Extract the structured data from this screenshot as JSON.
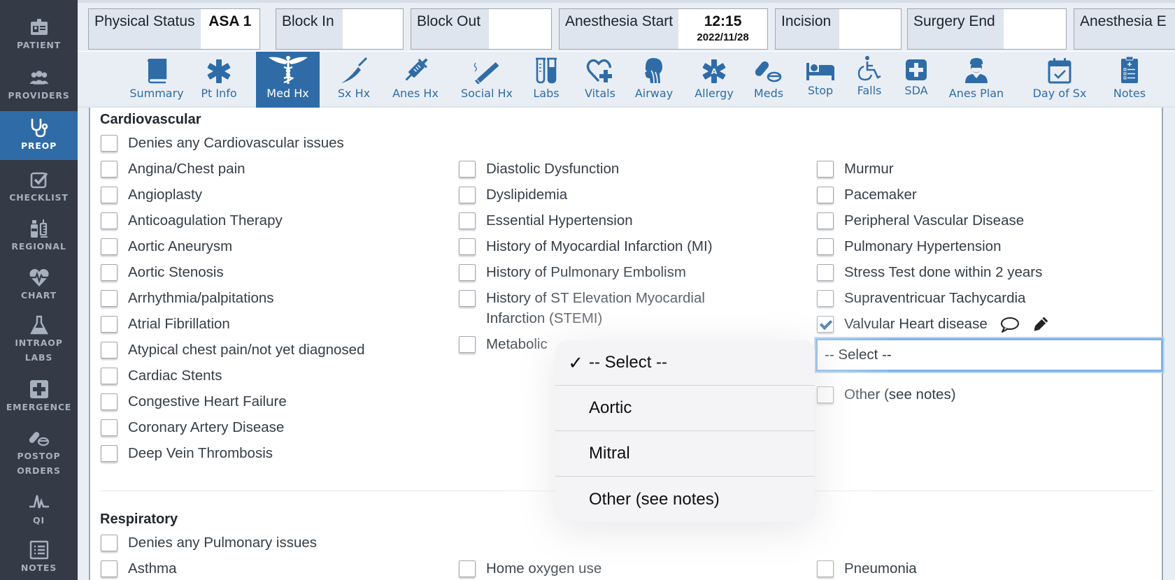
{
  "sidebar": {
    "items": [
      {
        "label": "PATIENT",
        "icon": "patient-id-badge-icon",
        "active": false
      },
      {
        "label": "PROVIDERS",
        "icon": "providers-group-icon",
        "active": false
      },
      {
        "label": "PREOP",
        "icon": "stethoscope-icon",
        "active": true
      },
      {
        "label": "CHECKLIST",
        "icon": "checklist-checkbox-icon",
        "active": false
      },
      {
        "label": "REGIONAL",
        "icon": "bottle-syringe-icon",
        "active": false
      },
      {
        "label": "CHART",
        "icon": "heart-pulse-icon",
        "active": false
      },
      {
        "label_line1": "INTRAOP",
        "label_line2": "LABS",
        "icon": "flask-icon",
        "active": false
      },
      {
        "label": "EMERGENCE",
        "icon": "medical-cross-icon",
        "active": false
      },
      {
        "label_line1": "POSTOP",
        "label_line2": "ORDERS",
        "icon": "pills-icon",
        "active": false
      },
      {
        "label": "QI",
        "icon": "ekg-wave-icon",
        "active": false
      },
      {
        "label": "NOTES",
        "icon": "list-document-icon",
        "active": false
      }
    ]
  },
  "status": {
    "physical_status": {
      "label": "Physical Status",
      "value": "ASA 1"
    },
    "block_in": {
      "label": "Block In",
      "value": ""
    },
    "block_out": {
      "label": "Block Out",
      "value": ""
    },
    "anesthesia_start": {
      "label": "Anesthesia Start",
      "time": "12:15",
      "date": "2022/11/28"
    },
    "incision": {
      "label": "Incision",
      "value": ""
    },
    "surgery_end": {
      "label": "Surgery End",
      "value": ""
    },
    "anesthesia_end": {
      "label": "Anesthesia E"
    }
  },
  "tabs": [
    {
      "label": "Summary",
      "icon": "book-icon"
    },
    {
      "label": "Pt Info",
      "icon": "asterisk-icon"
    },
    {
      "label": "Med Hx",
      "icon": "caduceus-icon",
      "active": true
    },
    {
      "label": "Sx Hx",
      "icon": "scalpel-icon"
    },
    {
      "label": "Anes Hx",
      "icon": "syringe-icon"
    },
    {
      "label": "Social Hx",
      "icon": "cigarette-icon"
    },
    {
      "label": "Labs",
      "icon": "test-tubes-icon"
    },
    {
      "label": "Vitals",
      "icon": "heart-plus-icon"
    },
    {
      "label": "Airway",
      "icon": "head-airway-icon"
    },
    {
      "label": "Allergy",
      "icon": "allergy-star-icon"
    },
    {
      "label": "Meds",
      "icon": "pills-icon"
    },
    {
      "label": "Stop",
      "icon": "bed-icon"
    },
    {
      "label": "Falls",
      "icon": "wheelchair-icon"
    },
    {
      "label": "SDA",
      "icon": "plus-square-icon"
    },
    {
      "label": "Anes Plan",
      "icon": "surgeon-icon"
    },
    {
      "label": "Day of Sx",
      "icon": "calendar-check-icon"
    },
    {
      "label": "Notes",
      "icon": "clipboard-list-icon"
    }
  ],
  "cardiovascular": {
    "title": "Cardiovascular",
    "denies": {
      "label": "Denies any Cardiovascular issues",
      "checked": false
    },
    "col1": [
      {
        "label": "Angina/Chest pain",
        "checked": false
      },
      {
        "label": "Angioplasty",
        "checked": false
      },
      {
        "label": "Anticoagulation Therapy",
        "checked": false
      },
      {
        "label": "Aortic Aneurysm",
        "checked": false
      },
      {
        "label": "Aortic Stenosis",
        "checked": false
      },
      {
        "label": "Arrhythmia/palpitations",
        "checked": false
      },
      {
        "label": "Atrial Fibrillation",
        "checked": false
      },
      {
        "label": "Atypical chest pain/not yet diagnosed",
        "checked": false
      },
      {
        "label": "Cardiac Stents",
        "checked": false
      },
      {
        "label": "Congestive Heart Failure",
        "checked": false
      },
      {
        "label": "Coronary Artery Disease",
        "checked": false
      },
      {
        "label": "Deep Vein Thrombosis",
        "checked": false
      }
    ],
    "col2": [
      {
        "label": "Diastolic Dysfunction",
        "checked": false
      },
      {
        "label": "Dyslipidemia",
        "checked": false
      },
      {
        "label": "Essential Hypertension",
        "checked": false
      },
      {
        "label": "History of Myocardial Infarction (MI)",
        "checked": false
      },
      {
        "label": "History of Pulmonary Embolism",
        "checked": false
      },
      {
        "label": "History of ST Elevation Myocardial Infarction (STEMI)",
        "checked": false
      },
      {
        "label": "Metabolic",
        "checked": false
      }
    ],
    "col3": [
      {
        "label": "Murmur",
        "checked": false
      },
      {
        "label": "Pacemaker",
        "checked": false
      },
      {
        "label": "Peripheral Vascular Disease",
        "checked": false
      },
      {
        "label": "Pulmonary Hypertension",
        "checked": false
      },
      {
        "label": "Stress Test done within 2 years",
        "checked": false
      },
      {
        "label": "Supraventricuar Tachycardia",
        "checked": false
      },
      {
        "label": "Valvular Heart disease",
        "checked": true
      }
    ],
    "valvular_select": {
      "value": "-- Select --"
    },
    "other": {
      "label": "Other (see notes)",
      "checked": false
    }
  },
  "popover": {
    "options": [
      {
        "label": "-- Select --",
        "selected": true
      },
      {
        "label": "Aortic",
        "selected": false
      },
      {
        "label": "Mitral",
        "selected": false
      },
      {
        "label": "Other (see notes)",
        "selected": false
      }
    ],
    "check_glyph": "✓"
  },
  "respiratory": {
    "title": "Respiratory",
    "denies": {
      "label": "Denies any Pulmonary issues",
      "checked": false
    },
    "row1": [
      {
        "label": "Asthma",
        "checked": false
      },
      {
        "label": "Home oxygen use",
        "checked": false
      },
      {
        "label": "Pneumonia",
        "checked": false
      }
    ]
  },
  "colors": {
    "accent": "#2f6ca7",
    "sidebar_bg": "#343a46",
    "sidebar_text": "#a7b0be"
  }
}
